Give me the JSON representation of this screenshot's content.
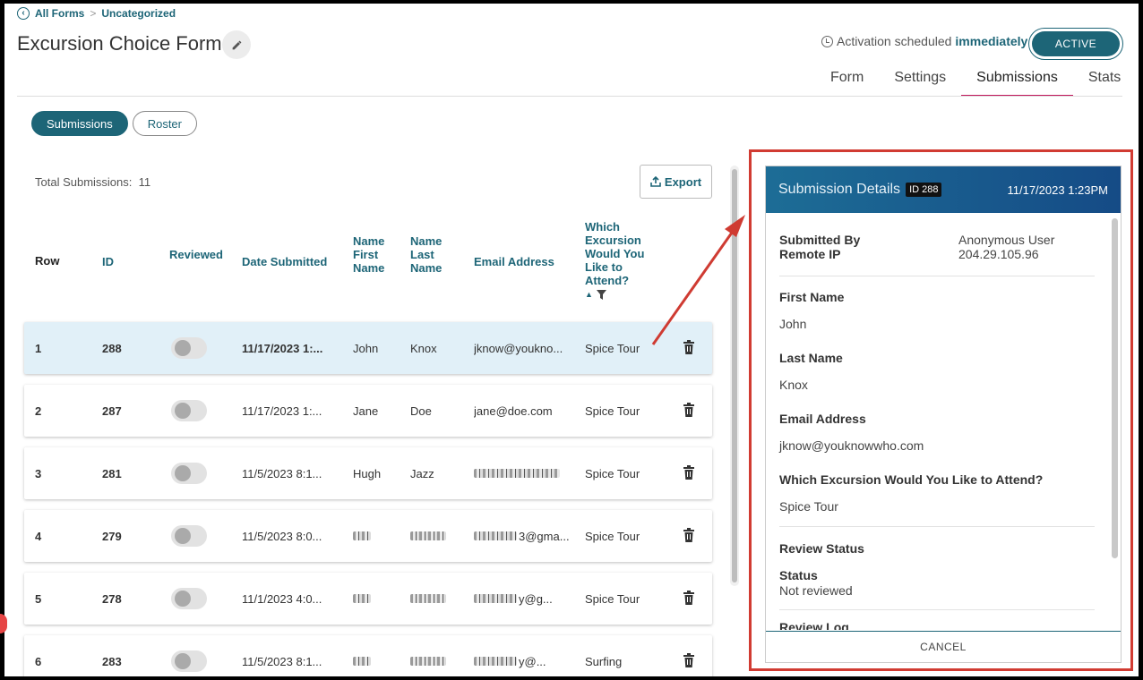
{
  "breadcrumb": {
    "root": "All Forms",
    "separator": ">",
    "current": "Uncategorized"
  },
  "page": {
    "title": "Excursion Choice Form"
  },
  "activation": {
    "prefix": "Activation scheduled",
    "value": "immediately",
    "status": "ACTIVE"
  },
  "tabs": [
    {
      "label": "Form"
    },
    {
      "label": "Settings"
    },
    {
      "label": "Submissions",
      "active": true
    },
    {
      "label": "Stats"
    }
  ],
  "view_toggle": {
    "submissions": "Submissions",
    "roster": "Roster",
    "selected": "Submissions"
  },
  "summary": {
    "label": "Total Submissions:",
    "count": "11"
  },
  "export_label": "Export",
  "table": {
    "headers": {
      "row": "Row",
      "id": "ID",
      "reviewed": "Reviewed",
      "date": "Date Submitted",
      "first_name": [
        "Name",
        "First",
        "Name"
      ],
      "last_name": [
        "Name",
        "Last",
        "Name"
      ],
      "email": "Email Address",
      "excursion": [
        "Which",
        "Excursion",
        "Would You",
        "Like to",
        "Attend?"
      ],
      "sort_indicator": "▲"
    },
    "rows": [
      {
        "row": "1",
        "id": "288",
        "date": "11/17/2023 1:...",
        "first": "John",
        "last": "Knox",
        "email": "jknow@youkno...",
        "excursion": "Spice Tour",
        "reviewed": false,
        "selected": true,
        "bold": true
      },
      {
        "row": "2",
        "id": "287",
        "date": "11/17/2023 1:...",
        "first": "Jane",
        "last": "Doe",
        "email": "jane@doe.com",
        "excursion": "Spice Tour",
        "reviewed": false
      },
      {
        "row": "3",
        "id": "281",
        "date": "11/5/2023 8:1...",
        "first": "Hugh",
        "last": "Jazz",
        "email": "",
        "email_redacted": true,
        "excursion": "Spice Tour",
        "reviewed": false
      },
      {
        "row": "4",
        "id": "279",
        "date": "11/5/2023 8:0...",
        "first": "",
        "first_redacted": true,
        "last": "",
        "last_redacted": true,
        "email": "3@gma...",
        "email_partial_redacted": true,
        "excursion": "Spice Tour",
        "reviewed": false
      },
      {
        "row": "5",
        "id": "278",
        "date": "11/1/2023 4:0...",
        "first": "",
        "first_redacted": true,
        "last": "",
        "last_redacted": true,
        "email": "y@g...",
        "email_partial_redacted": true,
        "excursion": "Spice Tour",
        "reviewed": false
      },
      {
        "row": "6",
        "id": "283",
        "date": "11/5/2023 8:1...",
        "first": "",
        "first_redacted": true,
        "last": "",
        "last_redacted": true,
        "email": "y@...",
        "email_partial_redacted": true,
        "excursion": "Surfing",
        "reviewed": false
      }
    ]
  },
  "details": {
    "title": "Submission Details",
    "id_badge": "ID 288",
    "date": "11/17/2023 1:23PM",
    "submitted_by_label": "Submitted By",
    "submitted_by_value": "Anonymous User",
    "remote_ip_label": "Remote IP",
    "remote_ip_value": "204.29.105.96",
    "fields": [
      {
        "label": "First Name",
        "value": "John"
      },
      {
        "label": "Last Name",
        "value": "Knox"
      },
      {
        "label": "Email Address",
        "value": "jknow@youknowwho.com"
      },
      {
        "label": "Which Excursion Would You Like to Attend?",
        "value": "Spice Tour"
      }
    ],
    "review_status_label": "Review Status",
    "status_label": "Status",
    "status_value": "Not reviewed",
    "review_log_label": "Review Log",
    "cancel_label": "CANCEL"
  },
  "colors": {
    "accent": "#1d6577",
    "highlight_border": "#d13b32",
    "tab_underline": "#c2185b",
    "panel_header": "#1d6d96"
  },
  "icons": [
    "back-circle-icon",
    "pencil-icon",
    "clock-icon",
    "export-icon",
    "filter-icon",
    "trash-icon"
  ]
}
